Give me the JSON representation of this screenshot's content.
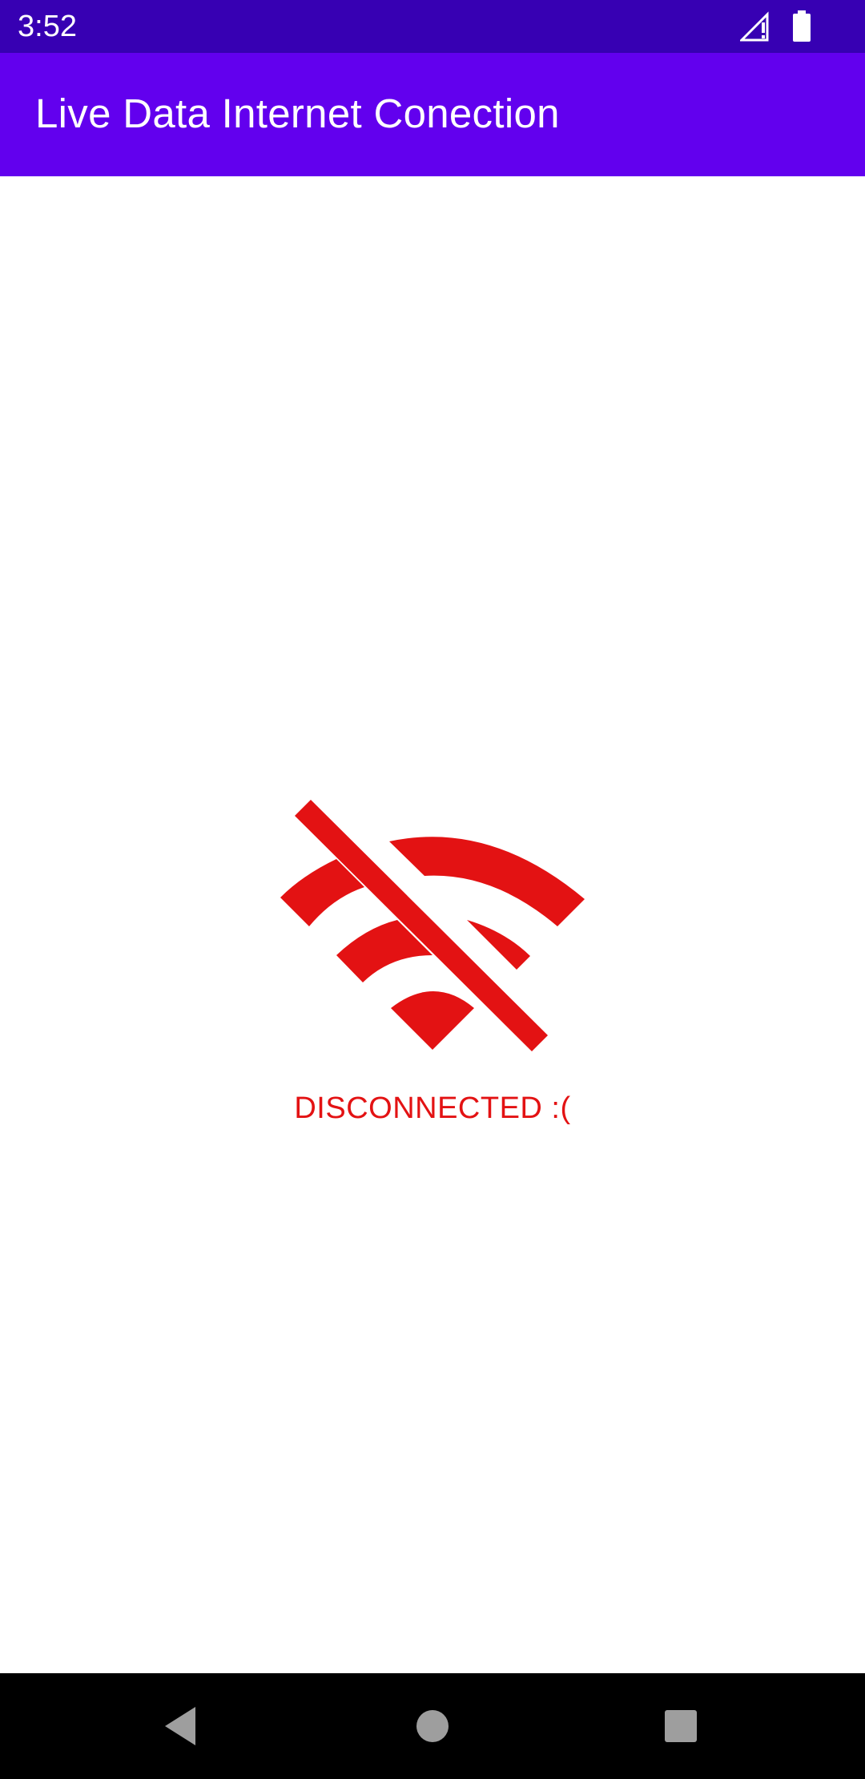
{
  "status_bar": {
    "time": "3:52",
    "icons": [
      "signal-no-data-icon",
      "battery-full-icon"
    ]
  },
  "app_bar": {
    "title": "Live Data Internet Conection",
    "color": "#6200ee"
  },
  "main": {
    "icon": "wifi-off-icon",
    "icon_color": "#e31213",
    "message": "DISCONNECTED :("
  },
  "navigation_bar": {
    "buttons": [
      "back-icon",
      "home-icon",
      "recents-icon"
    ]
  },
  "colors": {
    "status_bar": "#3700b3",
    "app_bar": "#6200ee",
    "accent_red": "#e31213",
    "nav_icons": "#9e9e9e"
  }
}
